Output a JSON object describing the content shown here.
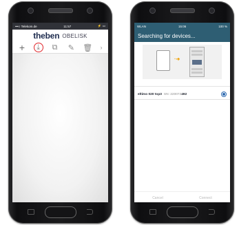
{
  "left_phone": {
    "status": {
      "carrier": "•••○ Telekom.de",
      "time": "11:57",
      "battery": "⚡ ▭"
    },
    "logo": {
      "brand": "theben",
      "product": "OBELISK"
    },
    "toolbar": [
      {
        "name": "add-icon",
        "glyph": "+"
      },
      {
        "name": "download-from-device-icon",
        "glyph": "⤓",
        "highlighted": true
      },
      {
        "name": "copy-icon",
        "glyph": "⧉"
      },
      {
        "name": "edit-icon",
        "glyph": "✎"
      },
      {
        "name": "delete-icon",
        "glyph": "🗑"
      },
      {
        "name": "chevron-right-icon",
        "glyph": "›"
      }
    ]
  },
  "right_phone": {
    "status": {
      "network": "WLAN",
      "time": "15:06",
      "battery": "100 %"
    },
    "title": "Searching for devices...",
    "device": {
      "name": "eltimo 020 top3",
      "sn_label": "SN: 220072",
      "sn_suffix": "492",
      "selected": true
    },
    "footer": {
      "cancel": "Cancel",
      "connect": "Connect"
    }
  },
  "colors": {
    "highlight_ring": "#e0262a",
    "header_teal": "#2e5e73",
    "radio_blue": "#2e6ab0",
    "arrow_orange": "#f0a000"
  }
}
